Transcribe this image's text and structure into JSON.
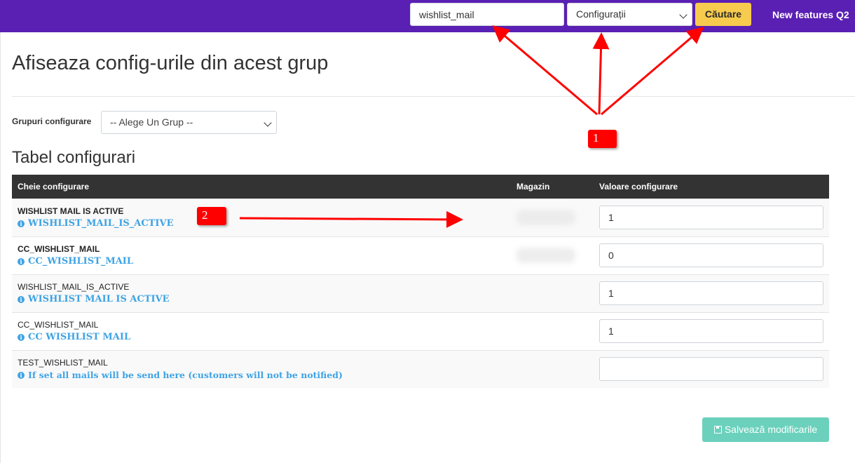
{
  "topbar": {
    "search_value": "wishlist_mail",
    "category_selected": "Configurații",
    "search_button": "Căutare",
    "nav_link": "New features Q2"
  },
  "page": {
    "title": "Afiseaza config-urile din acest grup",
    "group_label": "Grupuri configurare",
    "group_selected": "-- Alege Un Grup --",
    "table_title": "Tabel configurari"
  },
  "table": {
    "headers": [
      "Cheie configurare",
      "Magazin",
      "Valoare configurare"
    ],
    "rows": [
      {
        "key": "WISHLIST MAIL IS ACTIVE",
        "desc": "WISHLIST_MAIL_IS_ACTIVE",
        "value": "1"
      },
      {
        "key": "CC_WISHLIST_MAIL",
        "desc": "CC_WISHLIST_MAIL",
        "value": "0"
      },
      {
        "key": "WISHLIST_MAIL_IS_ACTIVE",
        "desc": "WISHLIST MAIL IS ACTIVE",
        "value": "1"
      },
      {
        "key": "CC_WISHLIST_MAIL",
        "desc": "CC WISHLIST MAIL",
        "value": "1"
      },
      {
        "key": "TEST_WISHLIST_MAIL",
        "desc": "If set all mails will be send here (customers will not be notified)",
        "value": ""
      }
    ]
  },
  "save_button": "Salvează modificarile",
  "annotations": {
    "marker1": "1",
    "marker2": "2"
  },
  "colors": {
    "topbar": "#5a1fb3",
    "search_button": "#f7cb4d",
    "link_blue": "#3ea3e4",
    "save_button": "#6bd1bc",
    "annotation_red": "#ff0000"
  },
  "icons": [
    "chevron-down-icon",
    "info-icon",
    "floppy-disk-icon"
  ]
}
